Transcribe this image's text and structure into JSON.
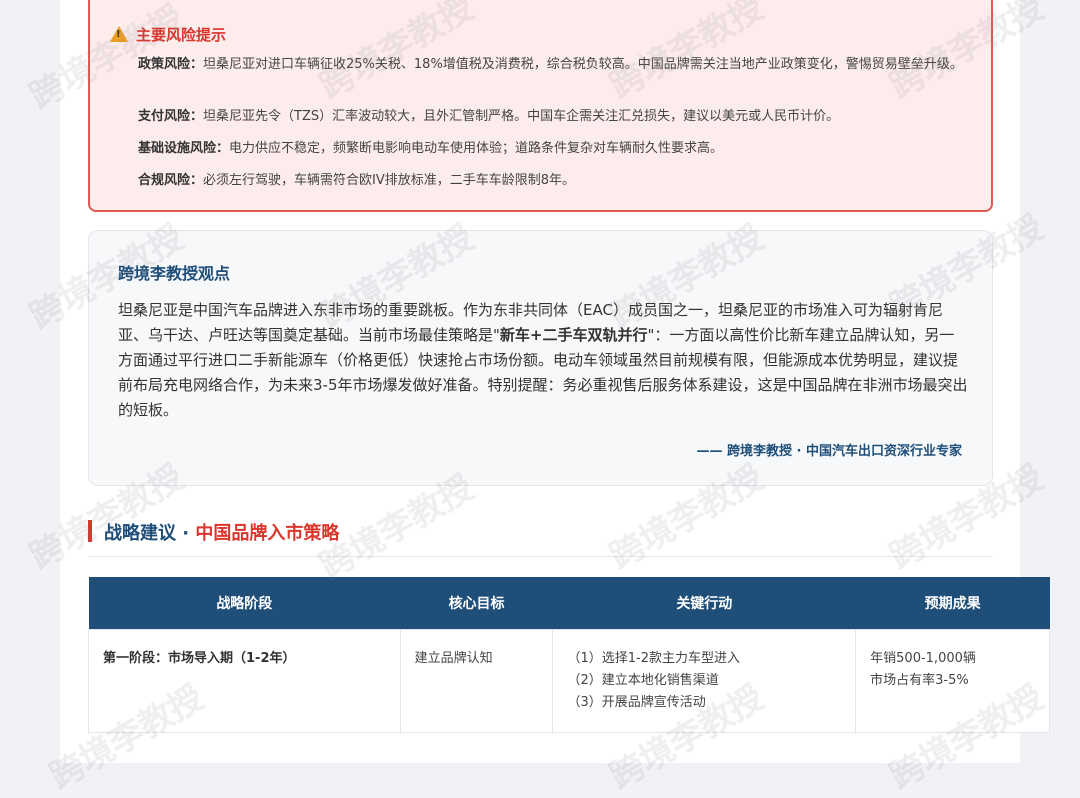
{
  "risk": {
    "title": "主要风险提示",
    "items": [
      {
        "label": "政策风险：",
        "text": "坦桑尼亚对进口车辆征收25%关税、18%增值税及消费税，综合税负较高。中国品牌需关注当地产业政策变化，警惕贸易壁垒升级。"
      },
      {
        "label": "支付风险：",
        "text": "坦桑尼亚先令（TZS）汇率波动较大，且外汇管制严格。中国车企需关注汇兑损失，建议以美元或人民币计价。"
      },
      {
        "label": "基础设施风险：",
        "text": "电力供应不稳定，频繁断电影响电动车使用体验；道路条件复杂对车辆耐久性要求高。"
      },
      {
        "label": "合规风险：",
        "text": "必须左行驾驶，车辆需符合欧IV排放标准，二手车车龄限制8年。"
      }
    ]
  },
  "opinion": {
    "title": "跨境李教授观点",
    "body_pre": "坦桑尼亚是中国汽车品牌进入东非市场的重要跳板。作为东非共同体（EAC）成员国之一，坦桑尼亚的市场准入可为辐射肯尼亚、乌干达、卢旺达等国奠定基础。当前市场最佳策略是\"",
    "body_bold": "新车+二手车双轨并行",
    "body_post": "\"：一方面以高性价比新车建立品牌认知，另一方面通过平行进口二手新能源车（价格更低）快速抢占市场份额。电动车领域虽然目前规模有限，但能源成本优势明显，建议提前布局充电网络合作，为未来3-5年市场爆发做好准备。特别提醒：务必重视售后服务体系建设，这是中国品牌在非洲市场最突出的短板。",
    "signature": "—— 跨境李教授 · 中国汽车出口资深行业专家"
  },
  "section": {
    "title_main": "战略建议 · ",
    "title_highlight": "中国品牌入市策略"
  },
  "table": {
    "headers": [
      "战略阶段",
      "核心目标",
      "关键行动",
      "预期成果"
    ],
    "rows": [
      {
        "stage": "第一阶段：市场导入期（1-2年）",
        "goal": "建立品牌认知",
        "actions": [
          "（1）选择1-2款主力车型进入",
          "（2）建立本地化销售渠道",
          "（3）开展品牌宣传活动"
        ],
        "results": [
          "年销500-1,000辆",
          "市场占有率3-5%"
        ]
      }
    ]
  },
  "watermark": "跨境李教授"
}
